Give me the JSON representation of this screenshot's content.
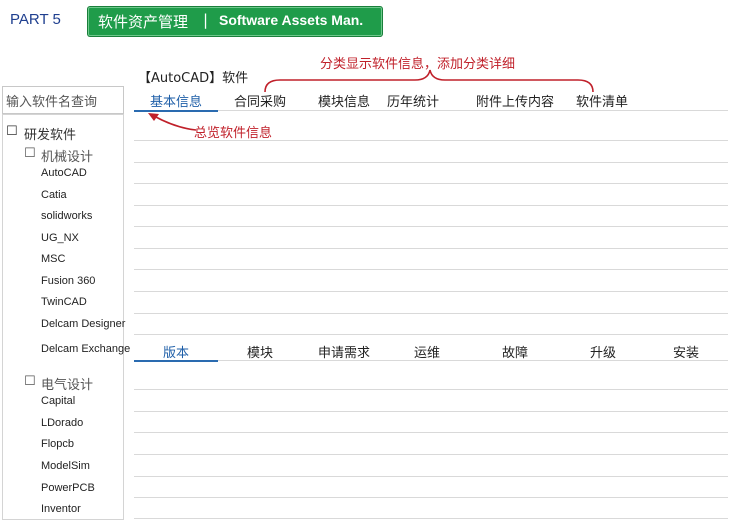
{
  "header": {
    "part_label": "PART 5",
    "banner_cn": "软件资产管理",
    "banner_sep": "|",
    "banner_en": "Software Assets Man."
  },
  "software_title": "【AutoCAD】软件",
  "annotations": {
    "tabs_note": "分类显示软件信息，添加分类详细",
    "overview_note": "总览软件信息"
  },
  "search": {
    "placeholder": "输入软件名查询"
  },
  "tree": {
    "root": {
      "box": "☐",
      "label": "研发软件"
    },
    "groups": [
      {
        "box": "☐",
        "label": "机械设计",
        "items": [
          "AutoCAD",
          "Catia",
          "solidworks",
          "UG_NX",
          "MSC",
          "Fusion 360",
          "TwinCAD",
          "Delcam Designer",
          "Delcam Exchange"
        ]
      },
      {
        "box": "☐",
        "label": "电气设计",
        "items": [
          "Capital",
          "LDorado",
          "Flopcb",
          "ModelSim",
          "PowerPCB",
          "Inventor"
        ]
      }
    ]
  },
  "top_tabs": [
    "基本信息",
    "合同采购",
    "模块信息",
    "历年统计",
    "附件上传内容",
    "软件清单"
  ],
  "bottom_tabs": [
    "版本",
    "模块",
    "申请需求",
    "运维",
    "故障",
    "升级",
    "安装"
  ],
  "colors": {
    "banner": "#1f9c4a",
    "annotation": "#c0202a",
    "active_tab": "#1f5fa8",
    "part_label": "#1f3f8f"
  }
}
